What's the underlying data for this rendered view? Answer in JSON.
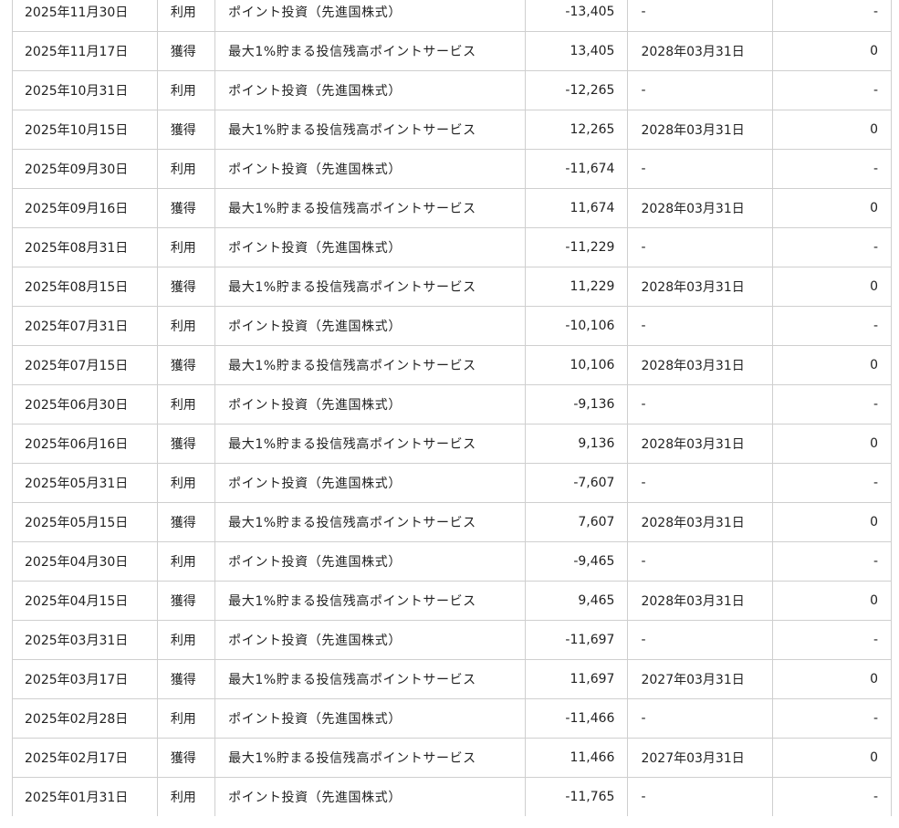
{
  "point_history": {
    "rows": [
      {
        "date": "2025年11月30日",
        "type": "利用",
        "description": "ポイント投資（先進国株式）",
        "points": "-13,405",
        "expiry": "-",
        "remaining": "-"
      },
      {
        "date": "2025年11月17日",
        "type": "獲得",
        "description": "最大1%貯まる投信残高ポイントサービス",
        "points": "13,405",
        "expiry": "2028年03月31日",
        "remaining": "0"
      },
      {
        "date": "2025年10月31日",
        "type": "利用",
        "description": "ポイント投資（先進国株式）",
        "points": "-12,265",
        "expiry": "-",
        "remaining": "-"
      },
      {
        "date": "2025年10月15日",
        "type": "獲得",
        "description": "最大1%貯まる投信残高ポイントサービス",
        "points": "12,265",
        "expiry": "2028年03月31日",
        "remaining": "0"
      },
      {
        "date": "2025年09月30日",
        "type": "利用",
        "description": "ポイント投資（先進国株式）",
        "points": "-11,674",
        "expiry": "-",
        "remaining": "-"
      },
      {
        "date": "2025年09月16日",
        "type": "獲得",
        "description": "最大1%貯まる投信残高ポイントサービス",
        "points": "11,674",
        "expiry": "2028年03月31日",
        "remaining": "0"
      },
      {
        "date": "2025年08月31日",
        "type": "利用",
        "description": "ポイント投資（先進国株式）",
        "points": "-11,229",
        "expiry": "-",
        "remaining": "-"
      },
      {
        "date": "2025年08月15日",
        "type": "獲得",
        "description": "最大1%貯まる投信残高ポイントサービス",
        "points": "11,229",
        "expiry": "2028年03月31日",
        "remaining": "0"
      },
      {
        "date": "2025年07月31日",
        "type": "利用",
        "description": "ポイント投資（先進国株式）",
        "points": "-10,106",
        "expiry": "-",
        "remaining": "-"
      },
      {
        "date": "2025年07月15日",
        "type": "獲得",
        "description": "最大1%貯まる投信残高ポイントサービス",
        "points": "10,106",
        "expiry": "2028年03月31日",
        "remaining": "0"
      },
      {
        "date": "2025年06月30日",
        "type": "利用",
        "description": "ポイント投資（先進国株式）",
        "points": "-9,136",
        "expiry": "-",
        "remaining": "-"
      },
      {
        "date": "2025年06月16日",
        "type": "獲得",
        "description": "最大1%貯まる投信残高ポイントサービス",
        "points": "9,136",
        "expiry": "2028年03月31日",
        "remaining": "0"
      },
      {
        "date": "2025年05月31日",
        "type": "利用",
        "description": "ポイント投資（先進国株式）",
        "points": "-7,607",
        "expiry": "-",
        "remaining": "-"
      },
      {
        "date": "2025年05月15日",
        "type": "獲得",
        "description": "最大1%貯まる投信残高ポイントサービス",
        "points": "7,607",
        "expiry": "2028年03月31日",
        "remaining": "0"
      },
      {
        "date": "2025年04月30日",
        "type": "利用",
        "description": "ポイント投資（先進国株式）",
        "points": "-9,465",
        "expiry": "-",
        "remaining": "-"
      },
      {
        "date": "2025年04月15日",
        "type": "獲得",
        "description": "最大1%貯まる投信残高ポイントサービス",
        "points": "9,465",
        "expiry": "2028年03月31日",
        "remaining": "0"
      },
      {
        "date": "2025年03月31日",
        "type": "利用",
        "description": "ポイント投資（先進国株式）",
        "points": "-11,697",
        "expiry": "-",
        "remaining": "-"
      },
      {
        "date": "2025年03月17日",
        "type": "獲得",
        "description": "最大1%貯まる投信残高ポイントサービス",
        "points": "11,697",
        "expiry": "2027年03月31日",
        "remaining": "0"
      },
      {
        "date": "2025年02月28日",
        "type": "利用",
        "description": "ポイント投資（先進国株式）",
        "points": "-11,466",
        "expiry": "-",
        "remaining": "-"
      },
      {
        "date": "2025年02月17日",
        "type": "獲得",
        "description": "最大1%貯まる投信残高ポイントサービス",
        "points": "11,466",
        "expiry": "2027年03月31日",
        "remaining": "0"
      },
      {
        "date": "2025年01月31日",
        "type": "利用",
        "description": "ポイント投資（先進国株式）",
        "points": "-11,765",
        "expiry": "-",
        "remaining": "-"
      }
    ]
  }
}
